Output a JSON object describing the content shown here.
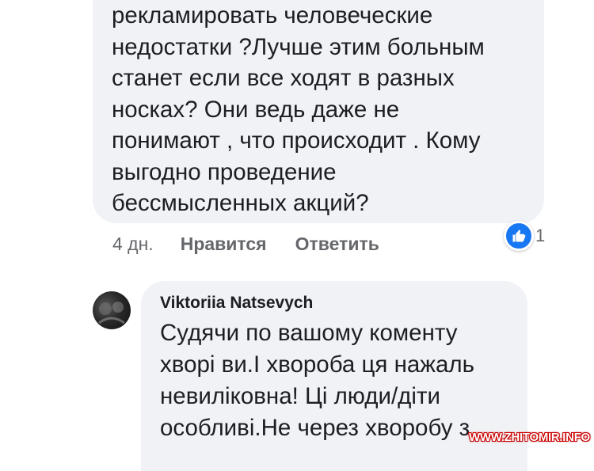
{
  "comment_1": {
    "text": "рекламировать человеческие\nнедостатки ?Лучше этим больным\nстанет если все ходят в разных\nносках? Они ведь даже не\nпонимают , что происходит . Кому\nвыгодно проведение\nбессмысленных акций?",
    "time": "4 дн.",
    "like_label": "Нравится",
    "reply_label": "Ответить",
    "reaction_icon": "like-icon",
    "reaction_count": "1"
  },
  "comment_2": {
    "author": "Viktoriia Natsevych",
    "text": "Судячи по вашому коменту\nхворі ви.І хвороба ця нажаль\nневиліковна! Ці люди/діти\nособливі.Не через хворобу з"
  },
  "watermark": "WWW.ZHITOMIR.INFO",
  "colors": {
    "bubble": "#f0f2f5",
    "text": "#1c1e21",
    "meta": "#65676b",
    "like": "#1877f2"
  }
}
